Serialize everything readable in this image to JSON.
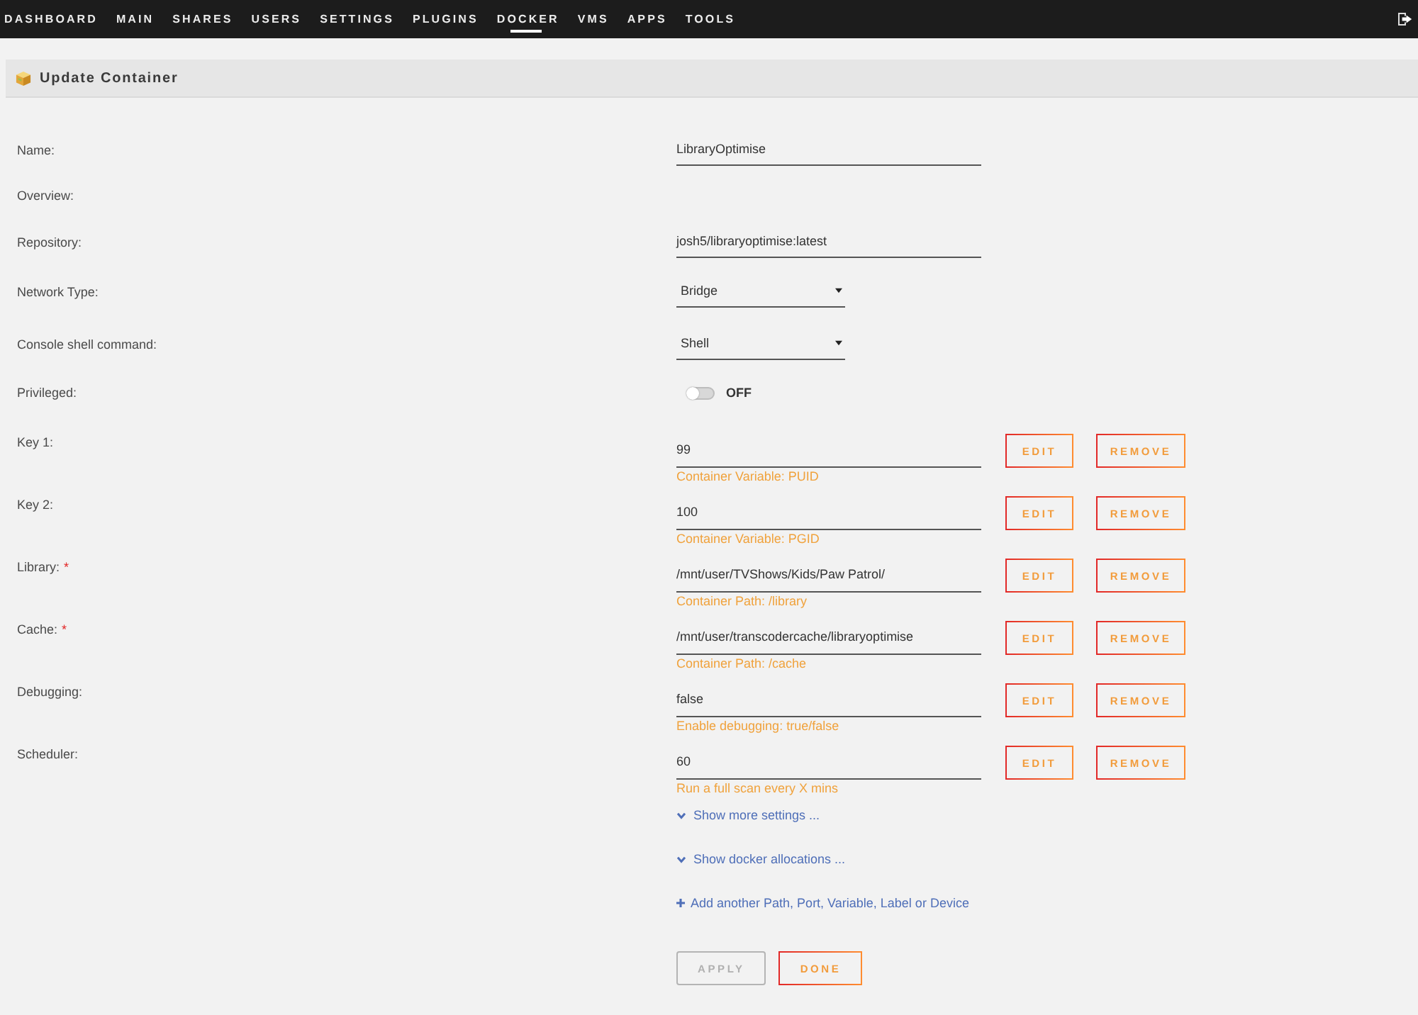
{
  "nav": {
    "items": [
      {
        "label": "DASHBOARD",
        "selected": false
      },
      {
        "label": "MAIN",
        "selected": false
      },
      {
        "label": "SHARES",
        "selected": false
      },
      {
        "label": "USERS",
        "selected": false
      },
      {
        "label": "SETTINGS",
        "selected": false
      },
      {
        "label": "PLUGINS",
        "selected": false
      },
      {
        "label": "DOCKER",
        "selected": true
      },
      {
        "label": "VMS",
        "selected": false
      },
      {
        "label": "APPS",
        "selected": false
      },
      {
        "label": "TOOLS",
        "selected": false
      }
    ]
  },
  "header": {
    "title": "Update Container"
  },
  "fields": [
    {
      "kind": "text",
      "label": "Name:",
      "value": "LibraryOptimise"
    },
    {
      "kind": "label",
      "label": "Overview:"
    },
    {
      "kind": "text",
      "label": "Repository:",
      "value": "josh5/libraryoptimise:latest"
    },
    {
      "kind": "select",
      "label": "Network Type:",
      "value": "Bridge"
    },
    {
      "kind": "select",
      "label": "Console shell command:",
      "value": "Shell"
    },
    {
      "kind": "toggle",
      "label": "Privileged:",
      "on": false,
      "state_text": "OFF"
    }
  ],
  "config": [
    {
      "label": "Key 1:",
      "value": "99",
      "description": "Container Variable: PUID",
      "edit": "EDIT",
      "remove": "REMOVE"
    },
    {
      "label": "Key 2:",
      "value": "100",
      "description": "Container Variable: PGID",
      "edit": "EDIT",
      "remove": "REMOVE"
    },
    {
      "label": "Library:",
      "required_mark": "*",
      "value": "/mnt/user/TVShows/Kids/Paw Patrol/",
      "description": "Container Path: /library",
      "edit": "EDIT",
      "remove": "REMOVE"
    },
    {
      "label": "Cache:",
      "required_mark": "*",
      "value": "/mnt/user/transcodercache/libraryoptimise",
      "description": "Container Path: /cache",
      "edit": "EDIT",
      "remove": "REMOVE"
    },
    {
      "label": "Debugging:",
      "value": "false",
      "description": "Enable debugging: true/false",
      "edit": "EDIT",
      "remove": "REMOVE"
    },
    {
      "label": "Scheduler:",
      "value": "60",
      "description": "Run a full scan every X mins",
      "edit": "EDIT",
      "remove": "REMOVE"
    }
  ],
  "links": [
    {
      "kind": "expand",
      "label": "Show more settings ..."
    },
    {
      "kind": "expand",
      "label": "Show docker allocations ..."
    },
    {
      "kind": "add",
      "label": "Add another Path, Port, Variable, Label or Device"
    }
  ],
  "buttons": [
    {
      "label": "APPLY",
      "disabled": true
    },
    {
      "label": "DONE",
      "disabled": false
    }
  ]
}
